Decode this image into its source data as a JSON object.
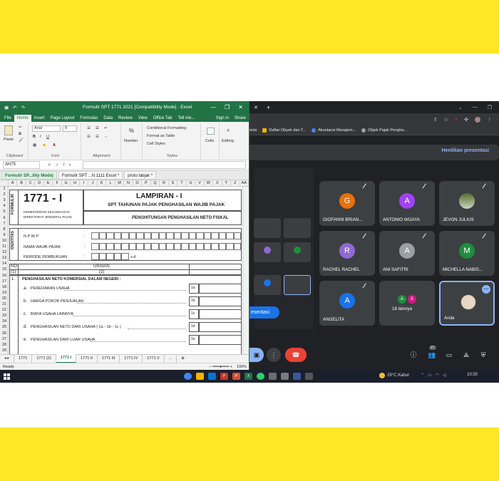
{
  "excel": {
    "title": "Formulir SPT 1771 2021  [Compatibility Mode] - Excel",
    "window_controls": [
      "—",
      "❐",
      "✕"
    ],
    "ribbon_tabs": [
      "File",
      "Home",
      "Insert",
      "Page Layout",
      "Formulas",
      "Data",
      "Review",
      "View",
      "Office Tab",
      "Tell me...",
      "Sign in",
      "Share"
    ],
    "ribbon": {
      "paste": "Paste",
      "clipboard": "Clipboard",
      "font_name": "Arial",
      "font_size": "8",
      "font": "Font",
      "alignment": "Alignment",
      "number": "Number",
      "percent": "%",
      "conditional": "Conditional Formatting",
      "format_table": "Format as Table",
      "cell_styles": "Cell Styles",
      "styles": "Styles",
      "cells": "Cells",
      "editing": "Editing"
    },
    "name_box": "AH75",
    "fx": "fx",
    "doc_tabs": [
      "Formulir SP...ility Mode)",
      "Formulir SPT ...N 1111 Excel *",
      "proto labjak *"
    ],
    "columns": [
      "A",
      "B",
      "C",
      "D",
      "E",
      "F",
      "G",
      "H",
      "I",
      "J",
      "K",
      "L",
      "M",
      "N",
      "O",
      "P",
      "Q",
      "R",
      "S",
      "T",
      "U",
      "V",
      "W",
      "X",
      "Y",
      "Z",
      "AA"
    ],
    "rows": [
      "1",
      "2",
      "3",
      "4",
      "5",
      "6",
      "7",
      "8",
      "9",
      "10",
      "11",
      "12",
      "13",
      "14",
      "15",
      "16",
      "17",
      "18",
      "19",
      "20",
      "21",
      "22",
      "23",
      "24",
      "25",
      "26",
      "27",
      "28",
      "29"
    ],
    "form": {
      "formulir": "FORMULIR",
      "code": "1771 - I",
      "ministry_1": "KEMENTERIAN KEUANGAN RI",
      "ministry_2": "DIREKTORAT JENDERAL PAJAK",
      "lampiran": "LAMPIRAN - I",
      "subtitle": "SPT TAHUNAN PAJAK PENGHASILAN WAJIB PAJAK",
      "section": "PENGHITUNGAN PENGHASILAN NETO FISKAL",
      "identitas": "IDENTITAS",
      "npwp": "N P W P",
      "nama": "NAMA WAJIB PAJAK",
      "periode": "PERIODE PEMBUKUAN",
      "sd": "s.d.",
      "colon": ":",
      "no": "NO",
      "uraian": "URAIAN",
      "col1": "(1)",
      "col2": "(2)",
      "item1_no": "1.",
      "item1": "PENGHASILAN NETO KOMERSIAL DALAM NEGERI :",
      "items": [
        {
          "l": "a.",
          "t": "PEREDARAN USAHA",
          "c": "1a"
        },
        {
          "l": "b.",
          "t": "HARGA POKOK PENJUALAN",
          "c": "1b"
        },
        {
          "l": "c.",
          "t": "BIAYA USAHA LAINNYA",
          "c": "1c"
        },
        {
          "l": "d.",
          "t": "PENGHASILAN NETO DARI USAHA ( 1a - 1b - 1c )",
          "c": "1d"
        },
        {
          "l": "e.",
          "t": "PENGHASILAN DARI LUAR USAHA",
          "c": "1e"
        }
      ]
    },
    "sheet_tabs": [
      "1771",
      "1771 (2)",
      "1771 I",
      "1771 II",
      "1771 III",
      "1771 IV",
      "1771 V",
      "..."
    ],
    "status": "Ready",
    "zoom": "100%"
  },
  "chrome": {
    "bookmarks": [
      "ents",
      "Daftar Obyek dan T...",
      "Akuntansi Manajem...",
      "Objek Pajak Pengha..."
    ],
    "stop_presenting": "Hentikan presentasi",
    "present_label": "esentasi",
    "participants": [
      {
        "name": "GIOFANNI BRIAN...",
        "initial": "G",
        "color": "#e8710a"
      },
      {
        "name": "ANTONIO WIJAYA",
        "initial": "A",
        "color": "#a142f4"
      },
      {
        "name": "JEVON JULIUS",
        "initial": "",
        "color": "#5f6368"
      },
      {
        "name": "RACHEL RACHEL",
        "initial": "R",
        "color": "#8e6ad1"
      },
      {
        "name": "ANI SAFITRI",
        "initial": "A",
        "color": "#9aa0a6"
      },
      {
        "name": "MICHELLA NABIS...",
        "initial": "M",
        "color": "#1e8e3e"
      },
      {
        "name": "ANGELITA",
        "initial": "A",
        "color": "#1a73e8"
      },
      {
        "name": "18 lainnya",
        "initial": "A",
        "color": "#1e8e3e",
        "initial2": "S",
        "color2": "#d01884"
      },
      {
        "name": "Anda",
        "initial": "",
        "color": "#3c4043"
      }
    ],
    "people_count": "27"
  },
  "taskbar": {
    "weather": "29°C  Kabut",
    "time": "10:30"
  }
}
